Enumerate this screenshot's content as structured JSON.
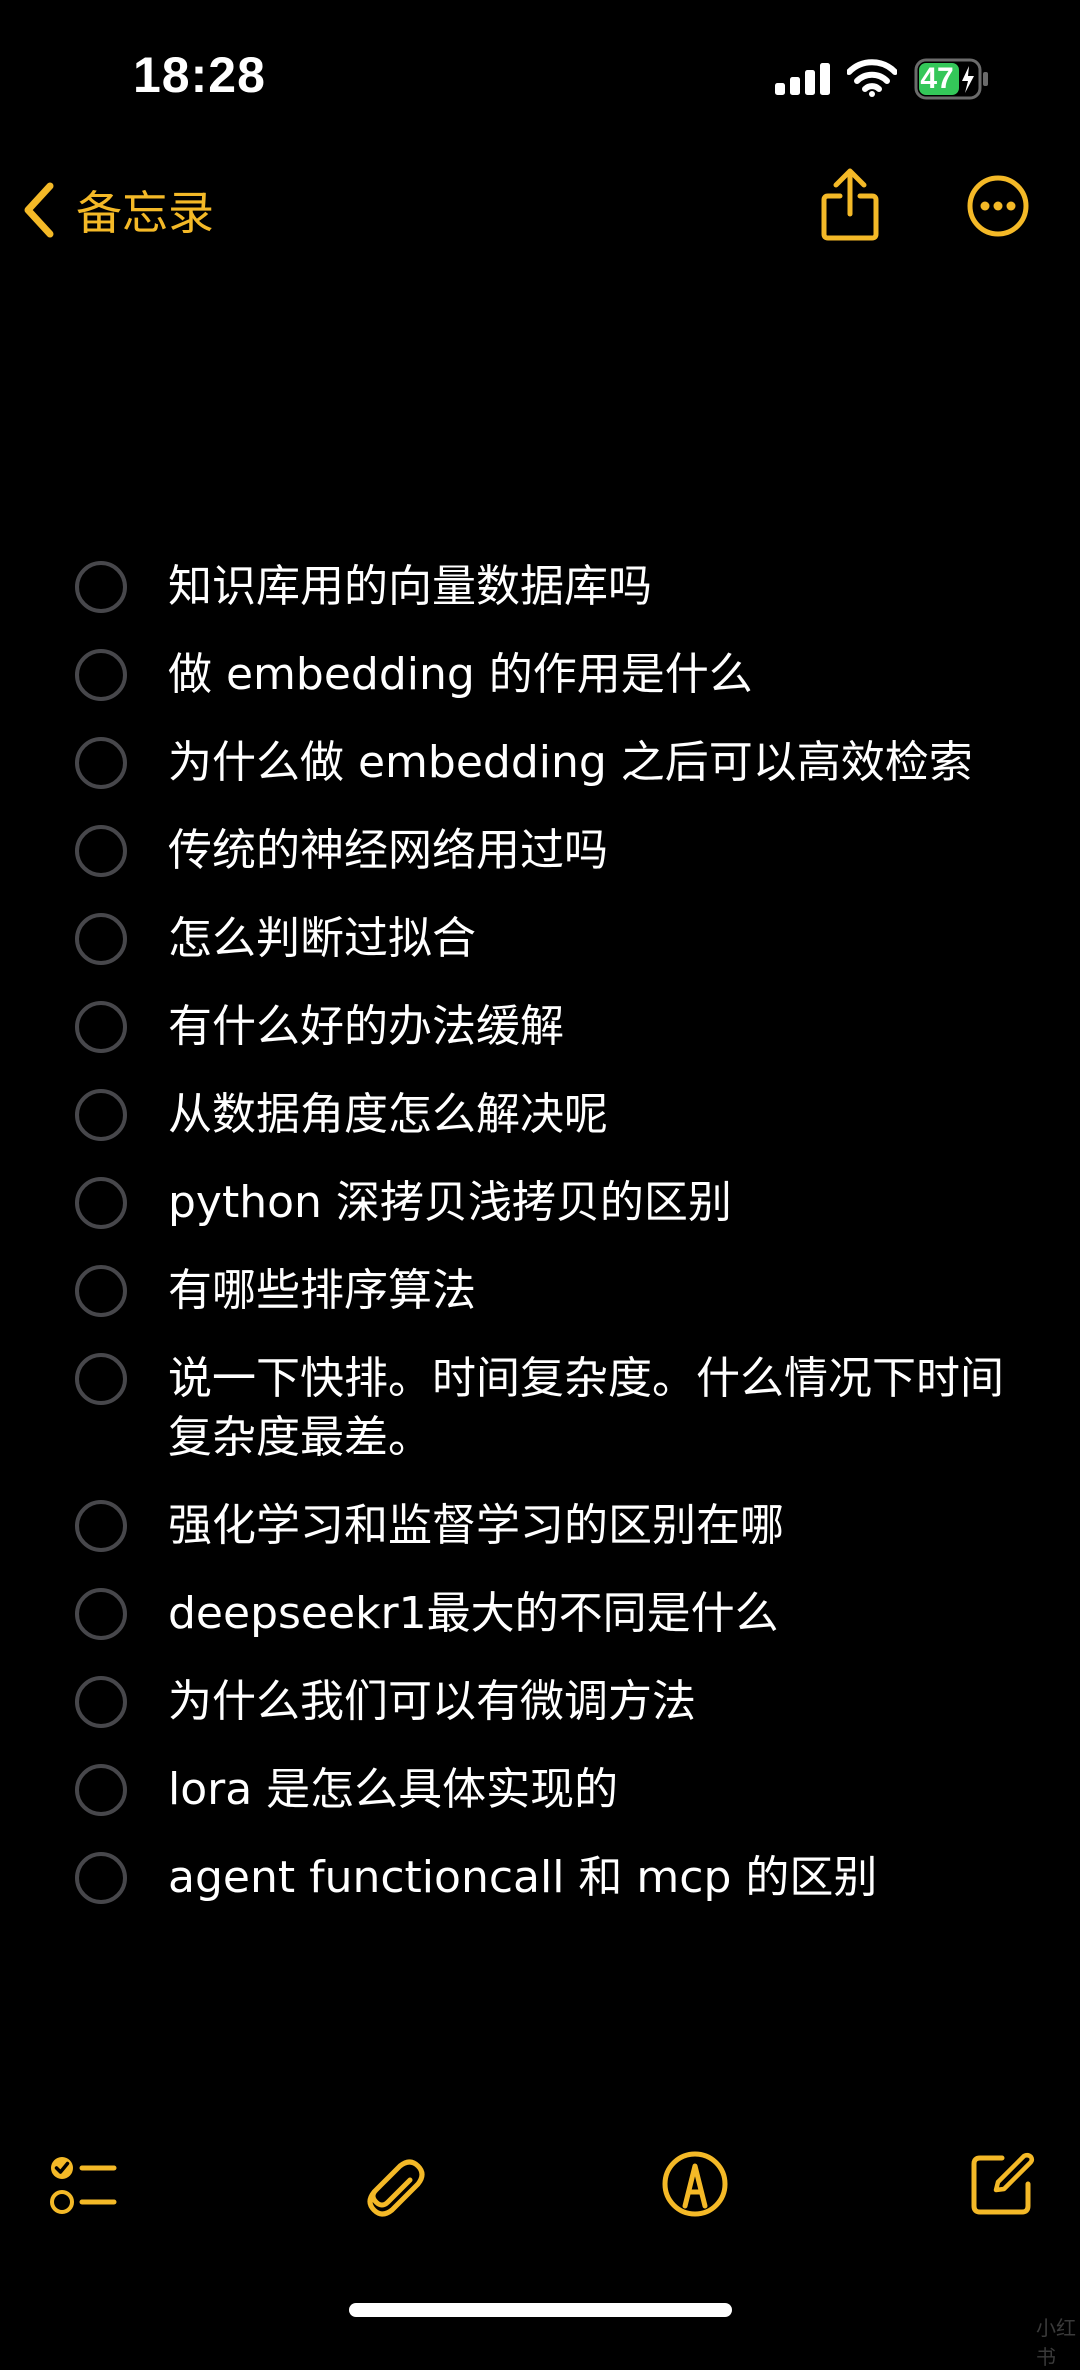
{
  "status_bar": {
    "time": "18:28",
    "battery_level": "47",
    "signal_icon": "cellular-signal-icon",
    "wifi_icon": "wifi-icon",
    "battery_icon": "battery-charging-icon"
  },
  "nav": {
    "back_label": "备忘录",
    "back_icon": "chevron-left-icon",
    "share_icon": "share-icon",
    "more_icon": "ellipsis-circle-icon"
  },
  "checklist": [
    {
      "text": "知识库用的向量数据库吗"
    },
    {
      "text": "做 embedding 的作用是什么"
    },
    {
      "text": "为什么做 embedding 之后可以高效检索"
    },
    {
      "text": "传统的神经网络用过吗"
    },
    {
      "text": "怎么判断过拟合"
    },
    {
      "text": "有什么好的办法缓解"
    },
    {
      "text": "从数据角度怎么解决呢"
    },
    {
      "text": "python 深拷贝浅拷贝的区别"
    },
    {
      "text": "有哪些排序算法"
    },
    {
      "text": "说一下快排。时间复杂度。什么情况下时间复杂度最差。"
    },
    {
      "text": "强化学习和监督学习的区别在哪"
    },
    {
      "text": "deepseekr1最大的不同是什么"
    },
    {
      "text": "为什么我们可以有微调方法"
    },
    {
      "text": "lora 是怎么具体实现的"
    },
    {
      "text": "agent  functioncall 和 mcp 的区别"
    }
  ],
  "toolbar": {
    "checklist_icon": "checklist-icon",
    "attach_icon": "paperclip-icon",
    "markup_icon": "markup-pen-icon",
    "compose_icon": "compose-icon"
  },
  "colors": {
    "accent": "#f4b927",
    "background": "#000000",
    "text": "#ffffff",
    "circle": "#47474b",
    "battery_fill": "#34c759"
  },
  "watermark": "小红书"
}
